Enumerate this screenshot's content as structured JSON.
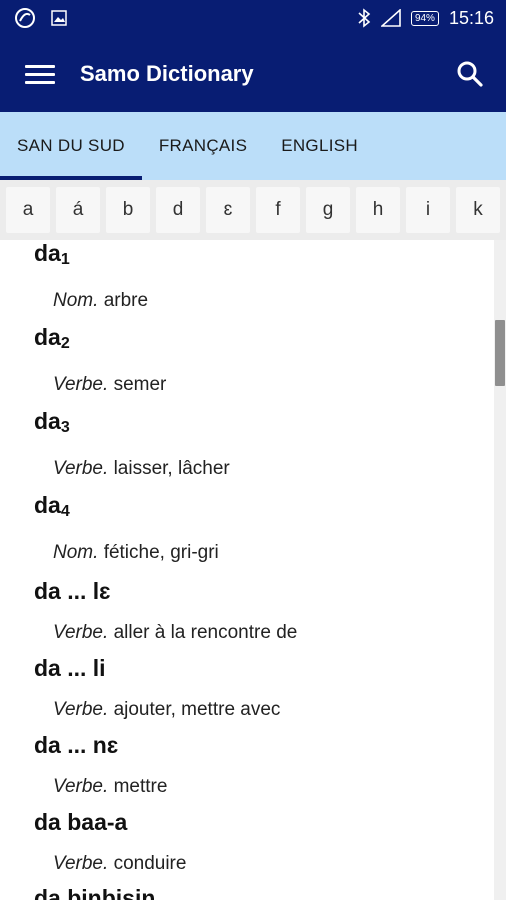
{
  "status_bar": {
    "left_icons": [
      "app-logo-icon",
      "image-icon"
    ],
    "right_icons": [
      "bluetooth-icon",
      "signal-icon"
    ],
    "battery": "94%",
    "time": "15:16"
  },
  "app_bar": {
    "title": "Samo Dictionary",
    "menu_icon": "menu-icon",
    "search_icon": "search-icon"
  },
  "tabs": [
    {
      "label": "SAN DU SUD",
      "active": true
    },
    {
      "label": "FRANÇAIS",
      "active": false
    },
    {
      "label": "ENGLISH",
      "active": false
    }
  ],
  "letters": [
    "a",
    "á",
    "b",
    "d",
    "ɛ",
    "f",
    "g",
    "h",
    "i",
    "k"
  ],
  "entries": [
    {
      "word": "da",
      "index": "1",
      "pos": "Nom.",
      "definition": "arbre"
    },
    {
      "word": "da",
      "index": "2",
      "pos": "Verbe.",
      "definition": "semer"
    },
    {
      "word": "da",
      "index": "3",
      "pos": "Verbe.",
      "definition": "laisser, lâcher"
    },
    {
      "word": "da",
      "index": "4",
      "pos": "Nom.",
      "definition": "fétiche, gri-gri"
    },
    {
      "word": "da ... lɛ",
      "index": "",
      "pos": "Verbe.",
      "definition": "aller à la rencontre de"
    },
    {
      "word": "da ... li",
      "index": "",
      "pos": "Verbe.",
      "definition": "ajouter, mettre avec"
    },
    {
      "word": "da ... nɛ",
      "index": "",
      "pos": "Verbe.",
      "definition": "mettre"
    },
    {
      "word": "da baa-a",
      "index": "",
      "pos": "Verbe.",
      "definition": "conduire"
    },
    {
      "word": "da binbisin",
      "index": "",
      "pos": "",
      "definition": ""
    }
  ],
  "colors": {
    "primary": "#081d73",
    "tab_bar": "#bbdef9",
    "letter_bar": "#ececec"
  }
}
